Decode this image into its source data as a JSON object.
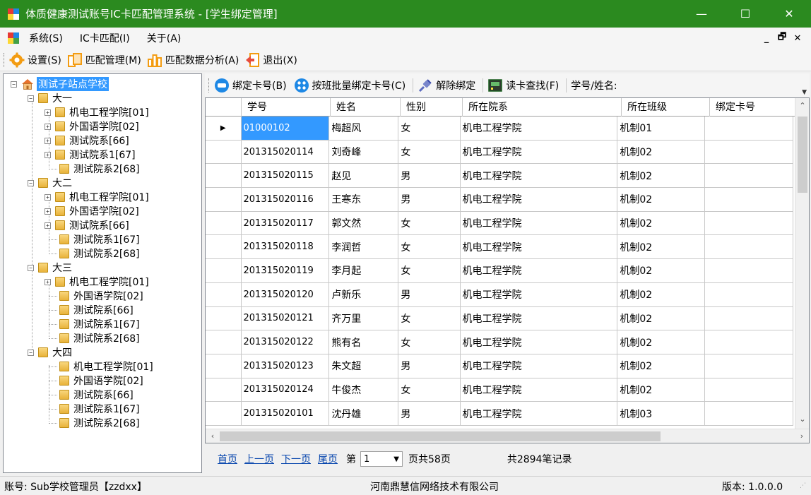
{
  "window": {
    "title": "体质健康测试账号IC卡匹配管理系统 - [学生绑定管理]",
    "controls": {
      "minimize": "—",
      "maximize": "☐",
      "close": "✕"
    },
    "accent": "#2b8a1f"
  },
  "menubar": {
    "items": [
      "系统(S)",
      "IC卡匹配(I)",
      "关于(A)"
    ],
    "mdi_controls": {
      "minimize": "_",
      "restore": "🗗",
      "close": "✕"
    }
  },
  "toolbar": {
    "items": [
      {
        "label": "设置(S)",
        "icon": "gear-icon"
      },
      {
        "label": "匹配管理(M)",
        "icon": "match-icon"
      },
      {
        "label": "匹配数据分析(A)",
        "icon": "chart-icon"
      },
      {
        "label": "退出(X)",
        "icon": "exit-icon"
      }
    ]
  },
  "tree": {
    "root": "测试子站点学校",
    "grades": [
      {
        "label": "大一",
        "depts": [
          {
            "label": "机电工程学院[01]",
            "expandable": true
          },
          {
            "label": "外国语学院[02]",
            "expandable": true
          },
          {
            "label": "测试院系[66]",
            "expandable": true
          },
          {
            "label": "测试院系1[67]",
            "expandable": true
          },
          {
            "label": "测试院系2[68]",
            "expandable": false
          }
        ]
      },
      {
        "label": "大二",
        "depts": [
          {
            "label": "机电工程学院[01]",
            "expandable": true
          },
          {
            "label": "外国语学院[02]",
            "expandable": true
          },
          {
            "label": "测试院系[66]",
            "expandable": true
          },
          {
            "label": "测试院系1[67]",
            "expandable": false
          },
          {
            "label": "测试院系2[68]",
            "expandable": false
          }
        ]
      },
      {
        "label": "大三",
        "depts": [
          {
            "label": "机电工程学院[01]",
            "expandable": true
          },
          {
            "label": "外国语学院[02]",
            "expandable": false
          },
          {
            "label": "测试院系[66]",
            "expandable": false
          },
          {
            "label": "测试院系1[67]",
            "expandable": false
          },
          {
            "label": "测试院系2[68]",
            "expandable": false
          }
        ]
      },
      {
        "label": "大四",
        "depts": [
          {
            "label": "机电工程学院[01]",
            "expandable": false
          },
          {
            "label": "外国语学院[02]",
            "expandable": false
          },
          {
            "label": "测试院系[66]",
            "expandable": false
          },
          {
            "label": "测试院系1[67]",
            "expandable": false
          },
          {
            "label": "测试院系2[68]",
            "expandable": false
          }
        ]
      }
    ]
  },
  "actions": {
    "bind": "绑定卡号(B)",
    "batch_bind": "按班批量绑定卡号(C)",
    "unbind": "解除绑定",
    "read_card": "读卡查找(F)",
    "search_label": "学号/姓名:"
  },
  "table": {
    "columns": [
      "学号",
      "姓名",
      "性别",
      "所在院系",
      "所在班级",
      "绑定卡号"
    ],
    "rows": [
      [
        "01000102",
        "梅超风",
        "女",
        "机电工程学院",
        "机制01",
        ""
      ],
      [
        "201315020114",
        "刘奇峰",
        "女",
        "机电工程学院",
        "机制02",
        ""
      ],
      [
        "201315020115",
        "赵见",
        "男",
        "机电工程学院",
        "机制02",
        ""
      ],
      [
        "201315020116",
        "王寒东",
        "男",
        "机电工程学院",
        "机制02",
        ""
      ],
      [
        "201315020117",
        "郭文然",
        "女",
        "机电工程学院",
        "机制02",
        ""
      ],
      [
        "201315020118",
        "李润哲",
        "女",
        "机电工程学院",
        "机制02",
        ""
      ],
      [
        "201315020119",
        "李月起",
        "女",
        "机电工程学院",
        "机制02",
        ""
      ],
      [
        "201315020120",
        "卢新乐",
        "男",
        "机电工程学院",
        "机制02",
        ""
      ],
      [
        "201315020121",
        "齐万里",
        "女",
        "机电工程学院",
        "机制02",
        ""
      ],
      [
        "201315020122",
        "熊有名",
        "女",
        "机电工程学院",
        "机制02",
        ""
      ],
      [
        "201315020123",
        "朱文超",
        "男",
        "机电工程学院",
        "机制02",
        ""
      ],
      [
        "201315020124",
        "牛俊杰",
        "女",
        "机电工程学院",
        "机制02",
        ""
      ],
      [
        "201315020101",
        "沈丹雄",
        "男",
        "机电工程学院",
        "机制03",
        ""
      ]
    ]
  },
  "pager": {
    "first": "首页",
    "prev": "上一页",
    "next": "下一页",
    "last": "尾页",
    "page_prefix": "第",
    "current_page": "1",
    "total_pages": "页共58页",
    "records": "共2894笔记录"
  },
  "status": {
    "account": "账号: Sub学校管理员【zzdxx】",
    "company": "河南鼎慧信网络技术有限公司",
    "version": "版本: 1.0.0.0"
  }
}
